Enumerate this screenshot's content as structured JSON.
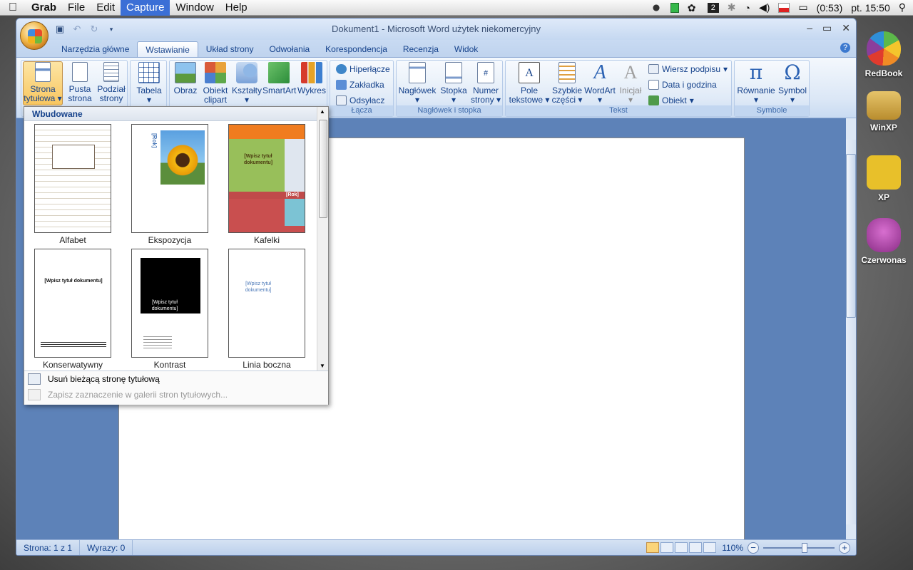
{
  "menubar": {
    "items": [
      "Grab",
      "File",
      "Edit",
      "Capture",
      "Window",
      "Help"
    ],
    "active_index": 3,
    "battery": "(0:53)",
    "clock": "pt. 15:50",
    "tray_badge": "2"
  },
  "desktop": {
    "icons": [
      "RedBook",
      "WinXP",
      "XP",
      "Czerwonas"
    ]
  },
  "window": {
    "title": "Dokument1 - Microsoft Word użytek niekomercyjny",
    "tabs": [
      "Narzędzia główne",
      "Wstawianie",
      "Układ strony",
      "Odwołania",
      "Korespondencja",
      "Recenzja",
      "Widok"
    ],
    "active_tab": "Wstawianie"
  },
  "ribbon": {
    "pages_group": {
      "cover": "Strona tytułowa",
      "blank": "Pusta strona",
      "break": "Podział strony"
    },
    "table": "Tabela",
    "illustrations": {
      "picture": "Obraz",
      "clipart": "Obiekt clipart",
      "shapes": "Kształty",
      "smartart": "SmartArt",
      "chart": "Wykres"
    },
    "links": {
      "label": "Łącza",
      "hyperlink": "Hiperłącze",
      "bookmark": "Zakładka",
      "crossref": "Odsyłacz"
    },
    "headerfooter": {
      "label": "Nagłówek i stopka",
      "header": "Nagłówek",
      "footer": "Stopka",
      "pagenum": "Numer strony"
    },
    "text": {
      "label": "Tekst",
      "textbox": "Pole tekstowe",
      "quickparts": "Szybkie części",
      "wordart": "WordArt",
      "dropcap": "Inicjał",
      "signature": "Wiersz podpisu",
      "datetime": "Data i godzina",
      "object": "Obiekt"
    },
    "symbols": {
      "label": "Symbole",
      "equation": "Równanie",
      "symbol": "Symbol"
    }
  },
  "gallery": {
    "header": "Wbudowane",
    "items": [
      "Alfabet",
      "Ekspozycja",
      "Kafelki",
      "Konserwatywny",
      "Kontrast",
      "Linia boczna"
    ],
    "placeholder_title": "[Wpisz tytuł dokumentu]",
    "placeholder_title_short": "[Wpisz tytuł dokumentu]",
    "placeholder_year": "[Rok]",
    "remove": "Usuń bieżącą stronę tytułową",
    "save": "Zapisz zaznaczenie w galerii stron tytułowych..."
  },
  "statusbar": {
    "page": "Strona: 1 z 1",
    "words": "Wyrazy: 0",
    "zoom": "110%"
  }
}
